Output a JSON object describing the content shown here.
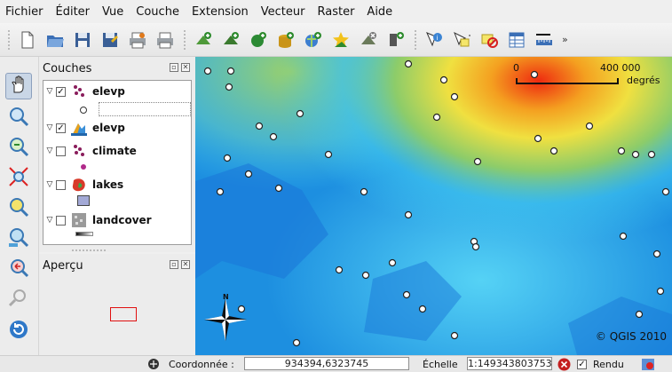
{
  "menu": [
    "Fichier",
    "Éditer",
    "Vue",
    "Couche",
    "Extension",
    "Vecteur",
    "Raster",
    "Aide"
  ],
  "toolbar": {
    "buttons": [
      "new-project",
      "open-project",
      "save-project",
      "save-as",
      "print-composer",
      "print",
      "add-vector-layer",
      "add-raster-layer",
      "add-postgis-layer",
      "add-spatialite-layer",
      "add-wms-layer",
      "new-shapefile-layer",
      "remove-layer",
      "add-wfs-layer",
      "identify",
      "select",
      "deselect",
      "attribute-table",
      "measure"
    ],
    "overflow": "»"
  },
  "layers_panel": {
    "title": "Couches",
    "layers": [
      {
        "name": "elevp",
        "checked": true,
        "expanded": true,
        "icon": "point-layer-icon"
      },
      {
        "name": "elevp",
        "checked": true,
        "expanded": true,
        "icon": "raster-layer-icon"
      },
      {
        "name": "climate",
        "checked": false,
        "expanded": true,
        "icon": "point-layer-icon"
      },
      {
        "name": "lakes",
        "checked": false,
        "expanded": true,
        "icon": "polygon-layer-icon"
      },
      {
        "name": "landcover",
        "checked": false,
        "expanded": true,
        "icon": "grid-layer-icon"
      }
    ]
  },
  "overview_panel": {
    "title": "Aperçu"
  },
  "map": {
    "scale_bar": {
      "left": "0",
      "right": "400 000",
      "unit": "degrés"
    },
    "copyright": "© QGIS 2010",
    "north_arrow": "N",
    "colors": {
      "low": "#1a8fe6",
      "mid": "#3ec5f0",
      "green": "#8ccc6a",
      "yellow": "#f0e040",
      "high": "#ee2a10"
    }
  },
  "status": {
    "coord_label": "Coordonnée :",
    "coord_value": "934394,6323745",
    "scale_label": "Échelle",
    "scale_value": "1:149343803753",
    "render_label": "Rendu",
    "render_checked": true
  }
}
